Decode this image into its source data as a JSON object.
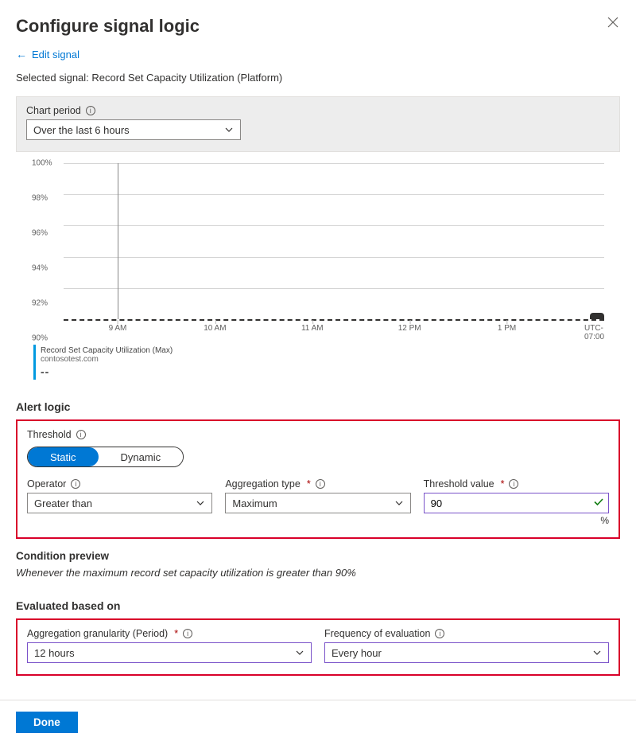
{
  "header": {
    "title": "Configure signal logic",
    "back_link": "Edit signal",
    "selected_signal_label": "Selected signal:",
    "selected_signal_value": "Record Set Capacity Utilization (Platform)"
  },
  "period": {
    "label": "Chart period",
    "value": "Over the last 6 hours"
  },
  "chart_data": {
    "type": "line",
    "title": "",
    "xlabel": "",
    "ylabel": "",
    "ylim": [
      90,
      100
    ],
    "y_ticks": [
      "100%",
      "98%",
      "96%",
      "94%",
      "92%",
      "90%"
    ],
    "x_ticks": [
      "9 AM",
      "10 AM",
      "11 AM",
      "12 PM",
      "1 PM"
    ],
    "timezone_label": "UTC-07:00",
    "threshold_line_value": 90,
    "series": [
      {
        "name": "Record Set Capacity Utilization (Max)",
        "source": "contosotest.com",
        "current_value_display": "--"
      }
    ]
  },
  "alert_logic": {
    "section_title": "Alert logic",
    "threshold_label": "Threshold",
    "threshold_options": {
      "static": "Static",
      "dynamic": "Dynamic",
      "selected": "static"
    },
    "operator": {
      "label": "Operator",
      "value": "Greater than"
    },
    "aggregation_type": {
      "label": "Aggregation type",
      "value": "Maximum"
    },
    "threshold_value": {
      "label": "Threshold value",
      "value": "90",
      "unit": "%"
    }
  },
  "condition_preview": {
    "title": "Condition preview",
    "text": "Whenever the maximum record set capacity utilization is greater than 90%"
  },
  "evaluated": {
    "title": "Evaluated based on",
    "granularity": {
      "label": "Aggregation granularity (Period)",
      "value": "12 hours"
    },
    "frequency": {
      "label": "Frequency of evaluation",
      "value": "Every hour"
    }
  },
  "footer": {
    "done": "Done"
  }
}
